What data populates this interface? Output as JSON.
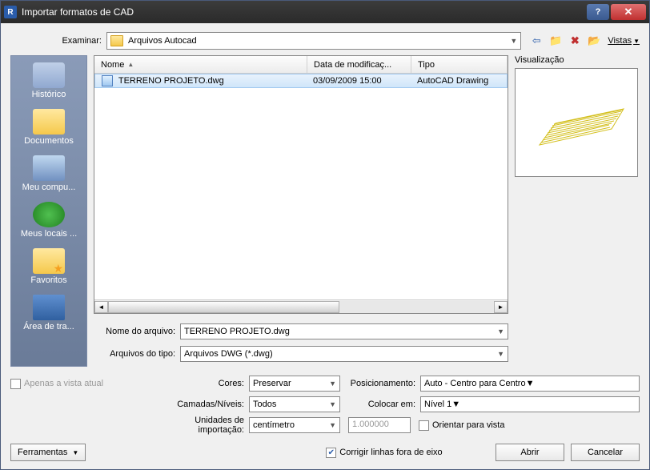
{
  "titlebar": {
    "title": "Importar formatos de CAD"
  },
  "lookin": {
    "label": "Examinar:",
    "value": "Arquivos Autocad"
  },
  "vistas": "Vistas",
  "places": {
    "history": "Histórico",
    "documents": "Documentos",
    "computer": "Meu compu...",
    "network": "Meus locais ...",
    "favorites": "Favoritos",
    "desktop": "Área de tra..."
  },
  "columns": {
    "name": "Nome",
    "date": "Data de modificaç...",
    "type": "Tipo"
  },
  "rows": [
    {
      "name": "TERRENO PROJETO.dwg",
      "date": "03/09/2009 15:00",
      "type": "AutoCAD Drawing"
    }
  ],
  "filename": {
    "label": "Nome do arquivo:",
    "value": "TERRENO PROJETO.dwg"
  },
  "filetype": {
    "label": "Arquivos do tipo:",
    "value": "Arquivos DWG  (*.dwg)"
  },
  "preview_label": "Visualização",
  "view_only": "Apenas a vista atual",
  "cores": {
    "label": "Cores:",
    "value": "Preservar"
  },
  "camadas": {
    "label": "Camadas/Níveis:",
    "value": "Todos"
  },
  "unidades": {
    "label": "Unidades de importação:",
    "value": "centímetro",
    "num": "1.000000"
  },
  "pos": {
    "label": "Posicionamento:",
    "value": "Auto - Centro para Centro"
  },
  "colocar": {
    "label": "Colocar em:",
    "value": "Nível 1"
  },
  "orientar": "Orientar para vista",
  "corrigir": "Corrigir linhas fora de eixo",
  "ferramentas": "Ferramentas",
  "abrir": "Abrir",
  "cancelar": "Cancelar"
}
